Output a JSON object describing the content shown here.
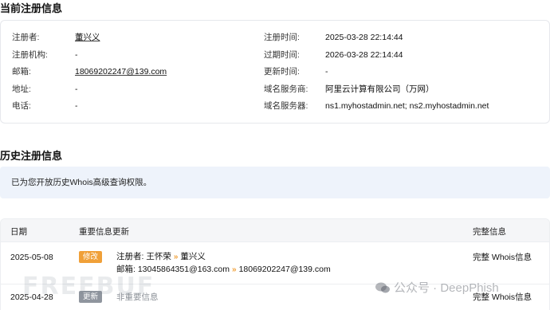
{
  "current": {
    "title": "当前注册信息",
    "left": [
      {
        "label": "注册者:",
        "value": "董兴义"
      },
      {
        "label": "注册机构:",
        "value": "-"
      },
      {
        "label": "邮箱:",
        "value": "18069202247@139.com"
      },
      {
        "label": "地址:",
        "value": "-"
      },
      {
        "label": "电话:",
        "value": "-"
      }
    ],
    "right": [
      {
        "label": "注册时间:",
        "value": "2025-03-28 22:14:44"
      },
      {
        "label": "过期时间:",
        "value": "2026-03-28 22:14:44"
      },
      {
        "label": "更新时间:",
        "value": "-"
      },
      {
        "label": "域名服务商:",
        "value": "阿里云计算有限公司（万网）"
      },
      {
        "label": "域名服务器:",
        "value": "ns1.myhostadmin.net; ns2.myhostadmin.net"
      }
    ]
  },
  "history": {
    "title": "历史注册信息",
    "notice": "已为您开放历史Whois高级查询权限。",
    "columns": [
      "日期",
      "重要信息更新",
      "完整信息"
    ],
    "rows": [
      {
        "date": "2025-05-08",
        "badge": "修改",
        "change1_label": "注册者:",
        "change1_old": "王怀荣",
        "change1_new": "董兴义",
        "change2_label": "邮箱:",
        "change2_old": "13045864351@163.com",
        "change2_new": "18069202247@139.com",
        "full_link": "完整 Whois信息"
      },
      {
        "date": "2025-04-28",
        "badge": "更新",
        "note": "非重要信息",
        "full_link": "完整 Whois信息"
      }
    ]
  },
  "arrow_glyph": "»",
  "watermark": {
    "left_text": "FREEBUF",
    "right_text": "公众号 · DeepPhish"
  },
  "colors": {
    "badge_modify": "#f0a038",
    "badge_update": "#8f959e",
    "notice_bg": "#eef3fb",
    "header_bg": "#f5f6f8"
  }
}
